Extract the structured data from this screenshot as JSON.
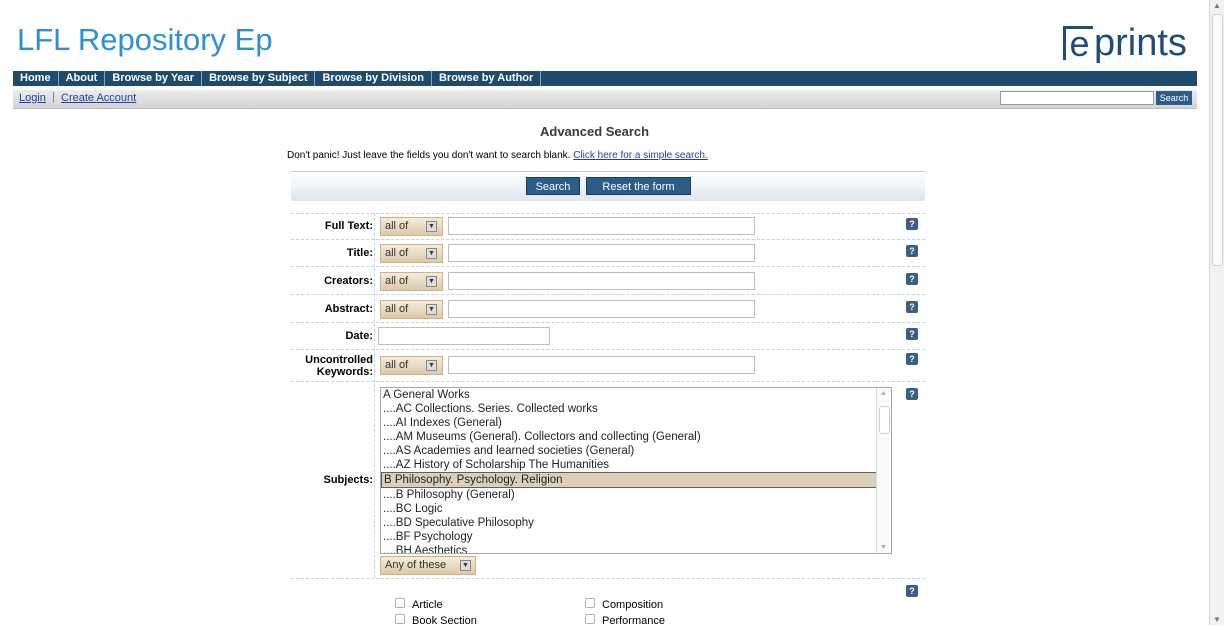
{
  "header": {
    "site_title": "LFL Repository Ep",
    "logo_text": "eprints"
  },
  "nav": {
    "items": [
      "Home",
      "About",
      "Browse by Year",
      "Browse by Subject",
      "Browse by Division",
      "Browse by Author"
    ]
  },
  "account": {
    "login": "Login",
    "separator": "|",
    "create": "Create Account",
    "quick_search_value": "",
    "quick_search_button": "Search"
  },
  "page": {
    "title": "Advanced Search",
    "intro": "Don't panic! Just leave the fields you don't want to search blank.",
    "simple_link": "Click here for a simple search.",
    "search_button": "Search",
    "reset_button": "Reset the form"
  },
  "fields": {
    "full_text": {
      "label": "Full Text:",
      "mode": "all of",
      "value": ""
    },
    "title": {
      "label": "Title:",
      "mode": "all of",
      "value": ""
    },
    "creators": {
      "label": "Creators:",
      "mode": "all of",
      "value": ""
    },
    "abstract": {
      "label": "Abstract:",
      "mode": "all of",
      "value": ""
    },
    "date": {
      "label": "Date:",
      "value": ""
    },
    "keywords": {
      "label1": "Uncontrolled",
      "label2": "Keywords:",
      "mode": "all of",
      "value": ""
    },
    "subjects": {
      "label": "Subjects:",
      "selected": "B Philosophy. Psychology. Religion",
      "items": [
        "A General Works",
        "....AC Collections. Series. Collected works",
        "....AI Indexes (General)",
        "....AM Museums (General). Collectors and collecting (General)",
        "....AS Academies and learned societies (General)",
        "....AZ History of Scholarship The Humanities",
        "B Philosophy. Psychology. Religion",
        "....B Philosophy (General)",
        "....BC Logic",
        "....BD Speculative Philosophy",
        "....BF Psychology",
        "....BH Aesthetics"
      ],
      "match": "Any of these"
    },
    "types": {
      "items": [
        "Article",
        "Composition",
        "Book Section",
        "Performance"
      ]
    }
  },
  "icons": {
    "help": "?"
  },
  "colors": {
    "brand_blue": "#2d8fd5",
    "nav_bg": "#1e4a6e",
    "button_bg": "#2c5c88",
    "select_bg": "#dcc9a9"
  }
}
